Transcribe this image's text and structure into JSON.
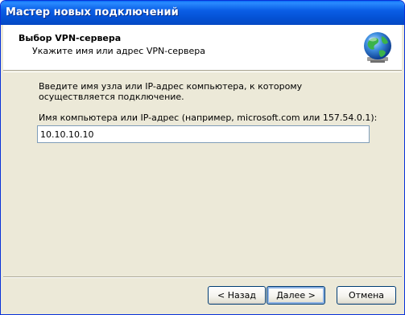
{
  "window": {
    "title": "Мастер новых подключений"
  },
  "header": {
    "title": "Выбор VPN-сервера",
    "subtitle": "Укажите имя или адрес VPN-сервера",
    "icon": "network-globe-icon"
  },
  "main": {
    "description": "Введите имя узла или IP-адрес компьютера, к  которому осуществляется подключение.",
    "field_label": "Имя компьютера или IP-адрес (например, microsoft.com или 157.54.0.1):",
    "host_value": "10.10.10.10"
  },
  "buttons": {
    "back_label": "< Назад",
    "next_label": "Далее >",
    "cancel_label": "Отмена"
  },
  "colors": {
    "titlebar": "#0452d5",
    "dialog_bg": "#ece9d8",
    "input_border": "#7f9db9"
  }
}
